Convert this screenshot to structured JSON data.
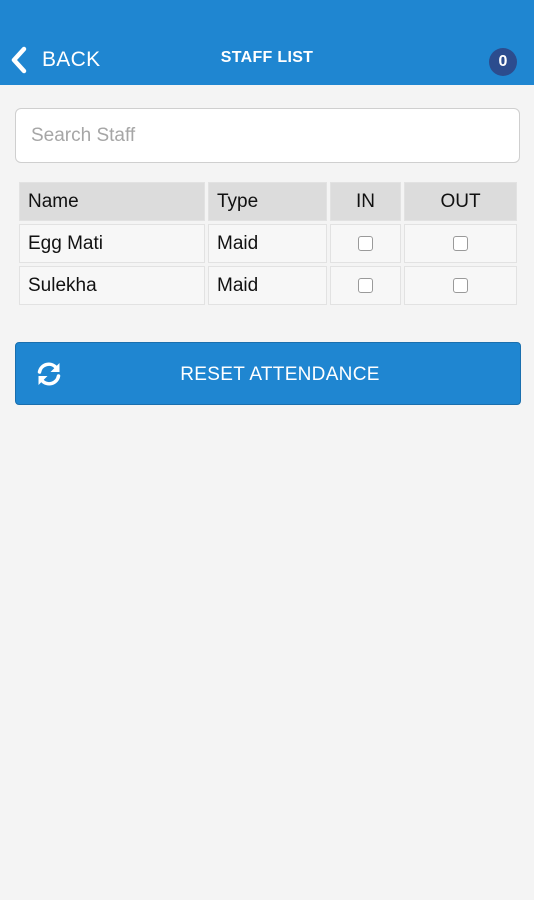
{
  "header": {
    "back_label": "BACK",
    "title": "STAFF LIST",
    "badge_count": "0"
  },
  "search": {
    "placeholder": "Search Staff",
    "value": ""
  },
  "table": {
    "headers": [
      "Name",
      "Type",
      "IN",
      "OUT"
    ],
    "rows": [
      {
        "name": "Egg Mati",
        "type": "Maid",
        "in_checked": false,
        "out_checked": false
      },
      {
        "name": "Sulekha",
        "type": "Maid",
        "in_checked": false,
        "out_checked": false
      }
    ]
  },
  "reset_button": {
    "label": "RESET ATTENDANCE",
    "icon": "refresh-icon"
  },
  "colors": {
    "primary": "#1f86d1",
    "badge": "#2c4c8e",
    "background": "#f4f4f4"
  }
}
